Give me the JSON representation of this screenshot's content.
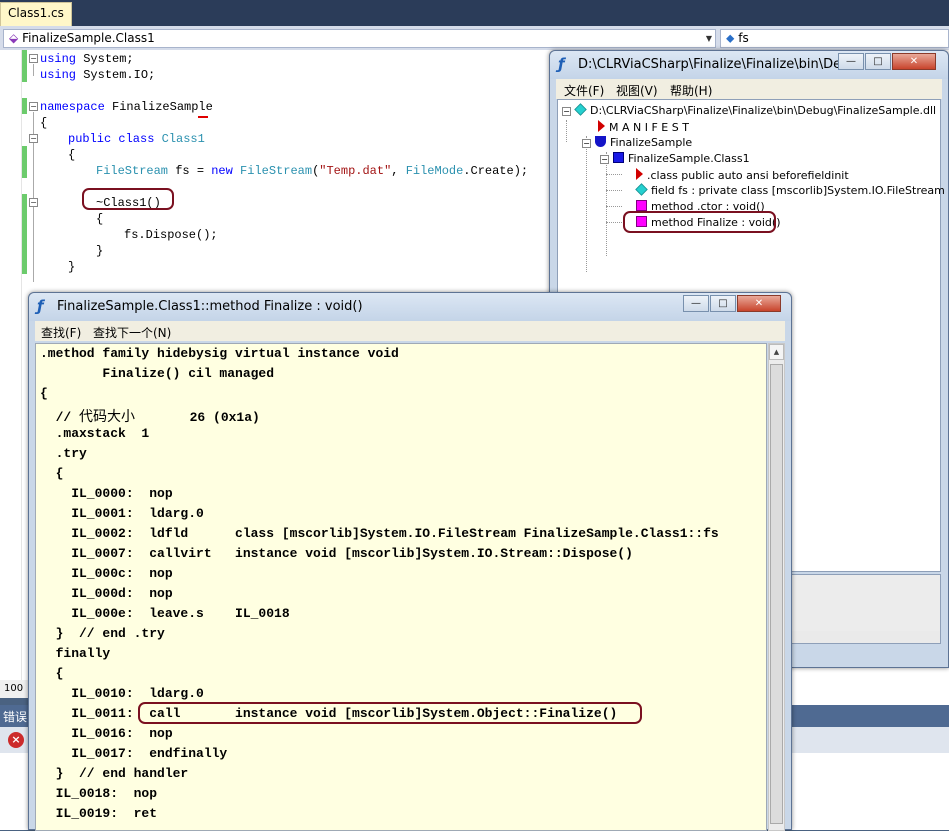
{
  "editor": {
    "tab_label": "Class1.cs",
    "nav_left": "FinalizeSample.Class1",
    "nav_right": "fs",
    "code": {
      "l1_kw": "using",
      "l1_rest": " System;",
      "l2_kw": "using",
      "l2_rest": " System.IO;",
      "l3_kw": "namespace",
      "l3_rest": " FinalizeSample",
      "l4": "{",
      "l5_kw": "public class",
      "l5_type": " Class1",
      "l6": "{",
      "l7_type1": "FileStream",
      "l7_mid1": " fs = ",
      "l7_kw": "new",
      "l7_type2": " FileStream",
      "l7_p1": "(",
      "l7_str": "\"Temp.dat\"",
      "l7_p2": ", ",
      "l7_type3": "FileMode",
      "l7_end": ".Create);",
      "l8": "~Class1()",
      "l9": "{",
      "l10": "fs.Dispose();",
      "l11": "}",
      "l12": "}"
    },
    "zoom": "100",
    "error_panel_title": "错误"
  },
  "tree_window": {
    "title": "D:\\CLRViaCSharp\\Finalize\\Finalize\\bin\\De...",
    "menu": [
      "文件(F)",
      "视图(V)",
      "帮助(H)"
    ],
    "nodes": {
      "root": "D:\\CLRViaCSharp\\Finalize\\Finalize\\bin\\Debug\\FinalizeSample.dll",
      "manifest": "M A N I F E S T",
      "namespace": "FinalizeSample",
      "class": "FinalizeSample.Class1",
      "class_decl": ".class public auto ansi beforefieldinit",
      "field": "field fs : private class [mscorlib]System.IO.FileStream",
      "ctor": "method .ctor : void()",
      "finalize": "method Finalize : void()"
    }
  },
  "il_window": {
    "title": "FinalizeSample.Class1::method Finalize : void()",
    "menu": [
      "查找(F)",
      "查找下一个(N)"
    ],
    "lines": [
      ".method family hidebysig virtual instance void",
      "        Finalize() cil managed",
      "{",
      "  // ",
      "  .maxstack  1",
      "  .try",
      "  {",
      "    IL_0000:  nop",
      "    IL_0001:  ldarg.0",
      "    IL_0002:  ldfld      class [mscorlib]System.IO.FileStream FinalizeSample.Class1::fs",
      "    IL_0007:  callvirt   instance void [mscorlib]System.IO.Stream::Dispose()",
      "    IL_000c:  nop",
      "    IL_000d:  nop",
      "    IL_000e:  leave.s    IL_0018",
      "  }  // end .try",
      "  finally",
      "  {",
      "    IL_0010:  ldarg.0",
      "    IL_0011:  call       instance void [mscorlib]System.Object::Finalize()",
      "    IL_0016:  nop",
      "    IL_0017:  endfinally",
      "  }  // end handler",
      "  IL_0018:  nop",
      "  IL_0019:  ret"
    ],
    "comment_zh": "代码大小",
    "comment_size": "       26 (0x1a)"
  }
}
